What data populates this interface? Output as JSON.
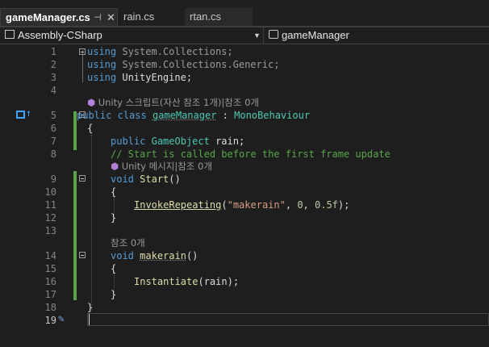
{
  "tabs": [
    {
      "label": "gameManager.cs",
      "active": true
    },
    {
      "label": "rain.cs",
      "active": false
    },
    {
      "label": "rtan.cs",
      "active": false
    }
  ],
  "tab_pin_glyph": "⊣",
  "tab_close_glyph": "✕",
  "nav": {
    "project": "Assembly-CSharp",
    "class": "gameManager"
  },
  "codelens": {
    "unity_script": "Unity 스크립트(자산 참조 1개)|참조 0개",
    "unity_message": "Unity 메시지|참조 0개",
    "refs0": "참조 0개"
  },
  "code": {
    "l1": {
      "kw": "using",
      "rest": " System.Collections;"
    },
    "l2": {
      "kw": "using",
      "rest": " System.Collections.Generic;"
    },
    "l3": {
      "kw": "using",
      "rest": " UnityEngine;"
    },
    "l5": {
      "kw1": "public",
      "kw2": "class",
      "name": "gameManager",
      "colon": " : ",
      "base": "MonoBehaviour"
    },
    "l6": "{",
    "l7": {
      "kw": "public",
      "type": "GameObject",
      "rest": " rain;"
    },
    "l8": "// Start is called before the first frame update",
    "l9": {
      "kw": "void",
      "fn": "Start",
      "rest": "()"
    },
    "l10": "{",
    "l11": {
      "fn": "InvokeRepeating",
      "p1": "(",
      "str": "\"makerain\"",
      "p2": ", ",
      "n1": "0",
      "p3": ", ",
      "n2": "0.5f",
      "p4": ");"
    },
    "l12": "}",
    "l14": {
      "kw": "void",
      "fn": "makerain",
      "rest": "()"
    },
    "l15": "{",
    "l16": {
      "fn": "Instantiate",
      "rest": "(rain);"
    },
    "l17": "}",
    "l18": "}"
  },
  "line_numbers": [
    "1",
    "2",
    "3",
    "4",
    "5",
    "6",
    "7",
    "8",
    "9",
    "10",
    "11",
    "12",
    "13",
    "14",
    "15",
    "16",
    "17",
    "18",
    "19"
  ],
  "colors": {
    "keyword": "#569cd6",
    "type": "#4ec9b0",
    "method": "#dcdcaa",
    "string": "#d69d85",
    "number": "#b5cea8",
    "comment": "#57a64a",
    "changed": "#57a64a"
  }
}
